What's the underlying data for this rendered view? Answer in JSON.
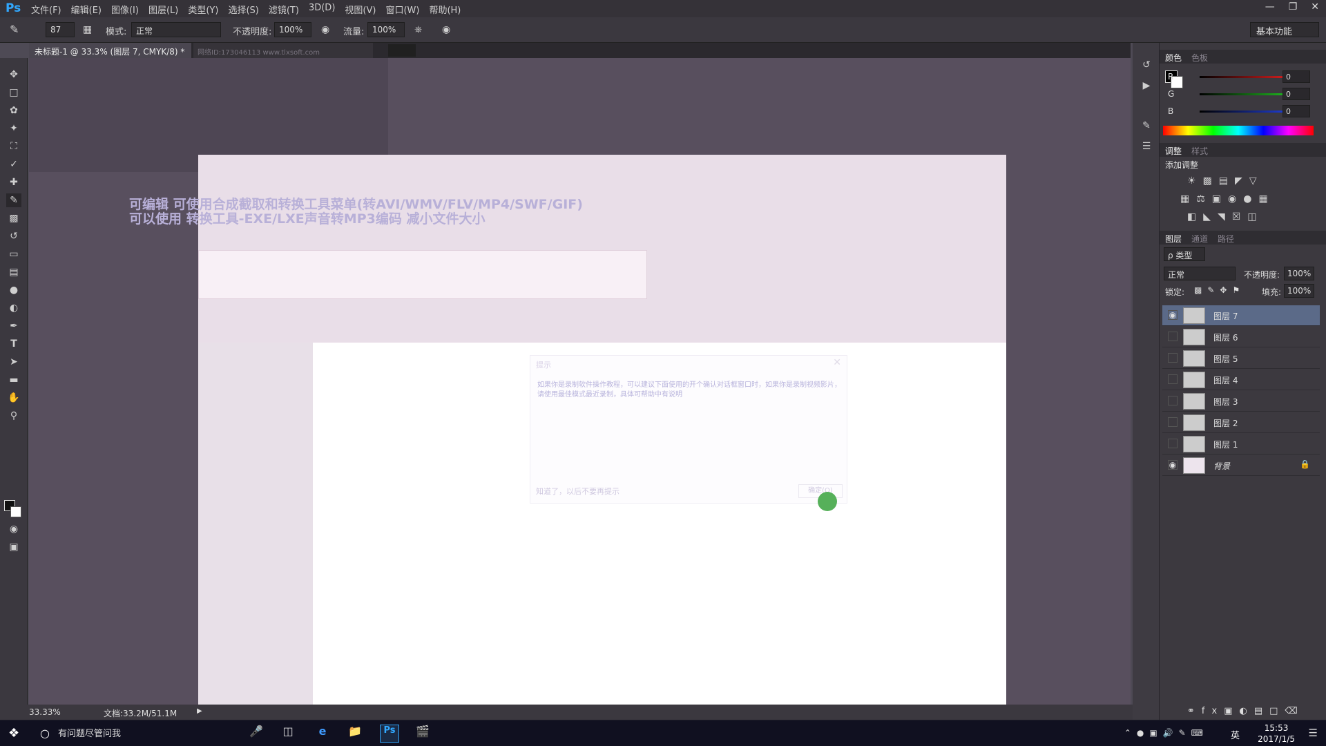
{
  "app": {
    "logo": "Ps",
    "menus": [
      "文件(F)",
      "编辑(E)",
      "图像(I)",
      "图层(L)",
      "类型(Y)",
      "选择(S)",
      "滤镜(T)",
      "3D(D)",
      "视图(V)",
      "窗口(W)",
      "帮助(H)"
    ]
  },
  "options_bar": {
    "brush_size": "87",
    "mode_label": "模式:",
    "mode_value": "正常",
    "opacity_label": "不透明度:",
    "opacity_value": "100%",
    "flow_label": "流量:",
    "flow_value": "100%",
    "workspace": "基本功能"
  },
  "document": {
    "tab_title": "未标题-1 @ 33.3% (图层 7, CMYK/8) *",
    "ghost_tab": "网络ID:173046113    www.tlxsoft.com",
    "ghost_heading_line1": "可编辑 可使用合成截取和转换工具菜单(转AVI/WMV/FLV/MP4/SWF/GIF)",
    "ghost_heading_line2": "可以使用 转换工具-EXE/LXE声音转MP3编码 减小文件大小"
  },
  "hint_dialog": {
    "title": "提示",
    "body": "如果你是录制软件操作教程，可以建议下面使用的开个确认对话框窗口时，如果你是录制视频影片，请使用最佳模式最近录制，具体可帮助中有说明",
    "footer_check": "知道了，以后不要再提示",
    "ok": "确定(O)"
  },
  "status": {
    "zoom": "33.33%",
    "doc_size": "文档:33.2M/51.1M"
  },
  "color_panel": {
    "tabs": [
      "颜色",
      "色板"
    ],
    "channels": [
      {
        "label": "R",
        "value": "0",
        "color": "#e02020"
      },
      {
        "label": "G",
        "value": "0",
        "color": "#20c020"
      },
      {
        "label": "B",
        "value": "0",
        "color": "#2040e0"
      }
    ]
  },
  "adjust_panel": {
    "tabs": [
      "调整",
      "样式"
    ],
    "title": "添加调整"
  },
  "layers_panel": {
    "tabs": [
      "图层",
      "通道",
      "路径"
    ],
    "kind_filter": "ρ 类型",
    "blend_mode": "正常",
    "opacity_label": "不透明度:",
    "opacity_value": "100%",
    "lock_label": "锁定:",
    "fill_label": "填充:",
    "fill_value": "100%",
    "layers": [
      {
        "name": "图层 7",
        "visible": true,
        "selected": true
      },
      {
        "name": "图层 6",
        "visible": false,
        "selected": false
      },
      {
        "name": "图层 5",
        "visible": false,
        "selected": false
      },
      {
        "name": "图层 4",
        "visible": false,
        "selected": false
      },
      {
        "name": "图层 3",
        "visible": false,
        "selected": false
      },
      {
        "name": "图层 2",
        "visible": false,
        "selected": false
      },
      {
        "name": "图层 1",
        "visible": false,
        "selected": false
      },
      {
        "name": "背景",
        "visible": true,
        "selected": false,
        "locked": true
      }
    ]
  },
  "taskbar": {
    "search": "有问题尽管问我",
    "ime": "英",
    "time": "15:53",
    "date": "2017/1/5"
  }
}
